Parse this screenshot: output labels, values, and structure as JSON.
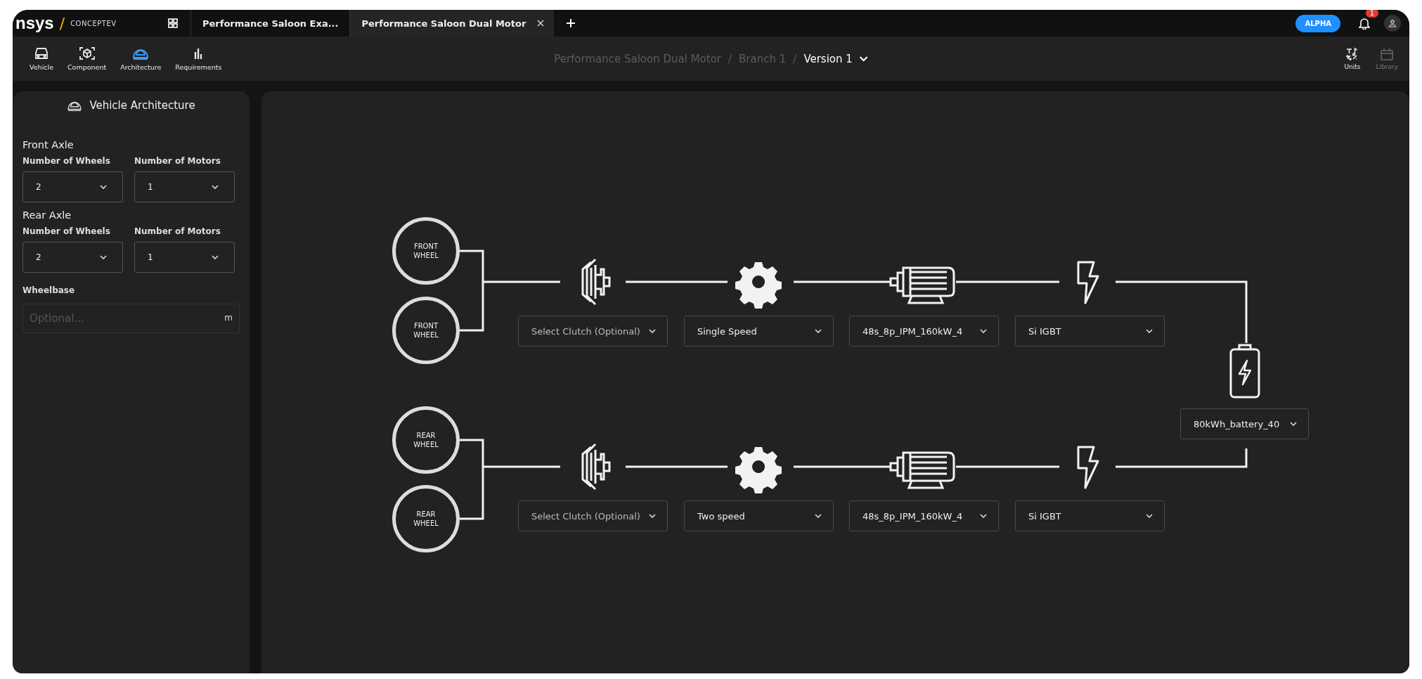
{
  "brand": {
    "name": "nsys",
    "separator": "/",
    "product": "CONCEPTEV"
  },
  "tabs": [
    {
      "label": "Performance Saloon Exa...",
      "selected": false
    },
    {
      "label": "Performance Saloon Dual Motor",
      "selected": true
    }
  ],
  "header": {
    "badge": "ALPHA",
    "notifications": "1"
  },
  "toolbar": [
    {
      "kind": "vehicle",
      "label": "Vehicle",
      "selected": false
    },
    {
      "kind": "component",
      "label": "Component",
      "selected": false
    },
    {
      "kind": "architecture",
      "label": "Architecture",
      "selected": true
    },
    {
      "kind": "requirements",
      "label": "Requirements",
      "selected": false
    }
  ],
  "breadcrumb": [
    {
      "label": "Performance Saloon Dual Motor",
      "current": false
    },
    {
      "separator": "/",
      "label": "Branch 1",
      "current": false
    },
    {
      "separator": "/",
      "label": "Version 1",
      "current": true
    }
  ],
  "tools": [
    {
      "kind": "units",
      "label": "Units",
      "disabled": false
    },
    {
      "kind": "library",
      "label": "Library",
      "disabled": true
    }
  ],
  "sidebar": {
    "title": "Vehicle Architecture",
    "axles": [
      {
        "title": "Front Axle",
        "fields": [
          {
            "label": "Number of Wheels",
            "value": "2"
          },
          {
            "label": "Number of Motors",
            "value": "1"
          }
        ]
      },
      {
        "title": "Rear Axle",
        "fields": [
          {
            "label": "Number of Wheels",
            "value": "2"
          },
          {
            "label": "Number of Motors",
            "value": "1"
          }
        ]
      }
    ],
    "wheelbase": {
      "label": "Wheelbase",
      "placeholder": "Optional...",
      "unit": "m"
    }
  },
  "diagram": {
    "axles": [
      {
        "wheels": [
          "FRONT WHEEL",
          "FRONT WHEEL"
        ],
        "components": [
          {
            "kind": "clutch",
            "placeholder": "Select Clutch (Optional)"
          },
          {
            "kind": "gearbox",
            "value": "Single Speed"
          },
          {
            "kind": "motor",
            "value": "48s_8p_IPM_160kW_4"
          },
          {
            "kind": "inverter",
            "value": "Si IGBT"
          }
        ]
      },
      {
        "wheels": [
          "REAR WHEEL",
          "REAR WHEEL"
        ],
        "components": [
          {
            "kind": "clutch",
            "placeholder": "Select Clutch (Optional)"
          },
          {
            "kind": "gearbox",
            "value": "Two speed"
          },
          {
            "kind": "motor",
            "value": "48s_8p_IPM_160kW_4"
          },
          {
            "kind": "inverter",
            "value": "Si IGBT"
          }
        ]
      }
    ],
    "battery": {
      "value": "80kWh_battery_40"
    }
  }
}
